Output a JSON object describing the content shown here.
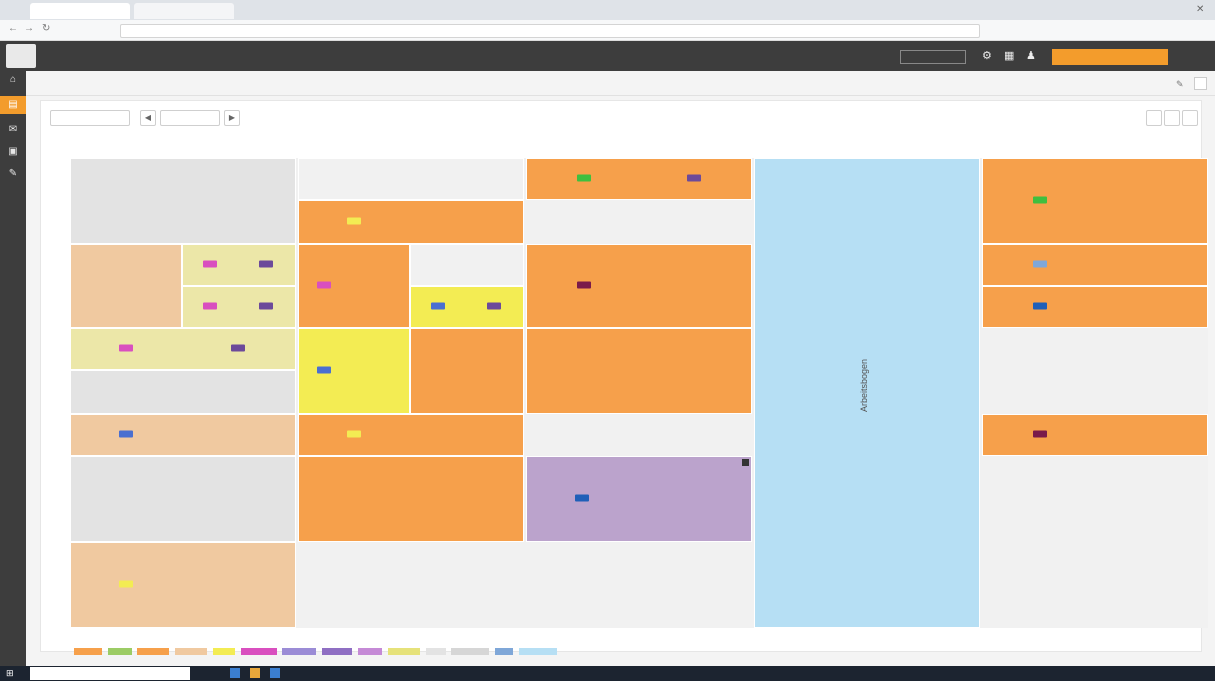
{
  "browser": {
    "tabs": [
      {
        "label": ""
      },
      {
        "label": ""
      }
    ],
    "url": ""
  },
  "app": {
    "title_line1": "",
    "title_line2": "",
    "school_selector": "",
    "orange_button": "",
    "header_link": ""
  },
  "colors": {
    "dark": "#3d3d3d",
    "orange": "#f6a04b",
    "tan": "#f0c9a0",
    "yellow": "#f3ec53",
    "pale_yellow": "#ece7a8",
    "purple": "#bba3cc",
    "light_blue": "#b6dff4",
    "gray": "#e3e3e3",
    "accent": "#f39c2c"
  },
  "sidebar_icons": [
    "home-icon",
    "calendar-icon",
    "chat-icon",
    "timetable-icon",
    "pen-icon"
  ],
  "breadcrumbs": [
    {
      "label": ""
    },
    {
      "label": ""
    }
  ],
  "toolbar": {
    "class_select": "",
    "date_field": "",
    "right_buttons": [
      "",
      "",
      ""
    ]
  },
  "timetable": {
    "days": [
      "",
      "",
      "",
      "",
      ""
    ],
    "times": [
      "",
      "",
      "",
      "",
      "",
      "",
      "",
      "",
      "",
      "",
      ""
    ],
    "free_label": "Arbeitsbogen",
    "blocks": [
      {
        "lessons": [
          [
            "",
            ""
          ],
          [
            "",
            ""
          ]
        ]
      },
      {
        "lessons": [
          [
            "",
            ""
          ],
          [
            "",
            ""
          ]
        ]
      },
      {
        "lessons": [
          [
            "",
            ""
          ],
          [
            "",
            ""
          ]
        ]
      },
      {
        "lessons": [
          [
            "",
            ""
          ],
          [
            "",
            ""
          ]
        ]
      },
      {
        "lessons": [
          [
            "",
            ""
          ],
          [
            "",
            ""
          ]
        ]
      },
      {
        "lessons": [
          [
            "",
            ""
          ],
          [
            "",
            ""
          ]
        ]
      },
      {
        "lessons": [
          [
            "",
            ""
          ],
          [
            "",
            ""
          ]
        ]
      },
      {
        "lessons": [
          [
            "",
            ""
          ],
          [
            "",
            ""
          ]
        ]
      },
      {
        "lessons": [
          [
            "",
            ""
          ],
          [
            "",
            ""
          ]
        ]
      },
      {
        "lessons": [
          [
            "",
            ""
          ],
          [
            "",
            ""
          ]
        ]
      },
      {
        "lessons": [
          [
            "",
            ""
          ],
          [
            "",
            ""
          ]
        ]
      },
      {
        "lessons": [
          [
            "",
            ""
          ],
          [
            "",
            ""
          ]
        ]
      },
      {
        "lessons": [
          [
            "",
            ""
          ],
          [
            "",
            ""
          ]
        ]
      },
      {
        "lessons": [
          [
            "",
            ""
          ],
          [
            "",
            ""
          ]
        ]
      },
      {
        "lessons": [
          [
            "",
            ""
          ],
          [
            "",
            ""
          ]
        ]
      },
      {
        "lessons": [
          [
            "",
            ""
          ],
          [
            "",
            ""
          ]
        ]
      },
      {
        "lessons": [
          [
            "",
            ""
          ],
          [
            "",
            ""
          ]
        ]
      },
      {
        "lessons": [
          [
            "",
            ""
          ],
          [
            "",
            ""
          ]
        ]
      },
      {
        "lessons": [
          [
            "",
            ""
          ],
          [
            "",
            ""
          ]
        ]
      },
      {
        "lessons": [
          [
            "",
            ""
          ],
          [
            "",
            ""
          ]
        ]
      },
      {
        "lessons": [
          [
            "",
            ""
          ],
          [
            "",
            ""
          ]
        ]
      }
    ]
  },
  "legend": {
    "label": "",
    "items": [
      "",
      "",
      "",
      "",
      "",
      "",
      "",
      "",
      "",
      "",
      "",
      "",
      "",
      ""
    ]
  },
  "footer_note": "",
  "taskbar": {
    "search": "",
    "clock": ""
  }
}
